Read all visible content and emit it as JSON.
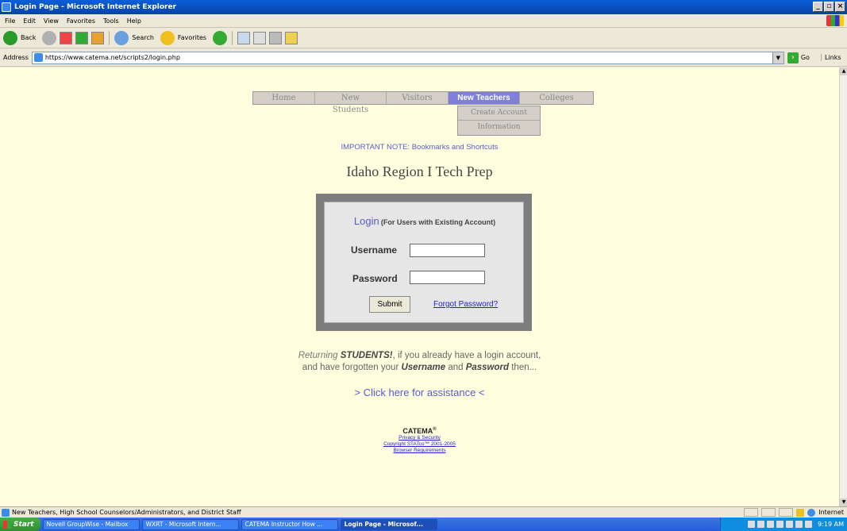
{
  "window": {
    "title": "Login Page - Microsoft Internet Explorer"
  },
  "menu": [
    "File",
    "Edit",
    "View",
    "Favorites",
    "Tools",
    "Help"
  ],
  "toolbar": {
    "back": "Back",
    "search": "Search",
    "favorites": "Favorites"
  },
  "address": {
    "label": "Address",
    "url": "https://www.catema.net/scripts2/login.php",
    "go": "Go",
    "links": "Links"
  },
  "nav": {
    "items": [
      "Home",
      "New Students",
      "Visitors",
      "New Teachers",
      "Colleges"
    ],
    "active": "New Teachers",
    "submenu": [
      "Create Account",
      "Information"
    ]
  },
  "page": {
    "important_note": "IMPORTANT NOTE: Bookmarks and Shortcuts",
    "site_title": "Idaho Region I Tech Prep",
    "login_title": "Login",
    "login_subtitle": "(For Users with Existing Account)",
    "username_label": "Username",
    "password_label": "Password",
    "submit": "Submit",
    "forgot": "Forgot Password?",
    "returning_1": "Returning",
    "returning_students": "STUDENTS!",
    "returning_2": ", if you already have a login account,",
    "returning_3": "and have forgotten your",
    "returning_username": "Username",
    "returning_and": "and",
    "returning_password": "Password",
    "returning_4": "then...",
    "assist": "> Click here for assistance <",
    "brand": "CATEMA",
    "brand_reg": "®",
    "privacy": "Privacy & Security",
    "copyright": "Copyright STATco™ 2001-2005",
    "browser_req": "Browser Requirements"
  },
  "status": {
    "text": "New Teachers, High School Counselors/Administrators, and District Staff",
    "zone": "Internet"
  },
  "taskbar": {
    "start": "Start",
    "tasks": [
      "Novell GroupWise - Mailbox",
      "WXRT - Microsoft Intern...",
      "CATEMA Instructor How ...",
      "Login Page - Microsof..."
    ],
    "clock": "9:19 AM"
  }
}
